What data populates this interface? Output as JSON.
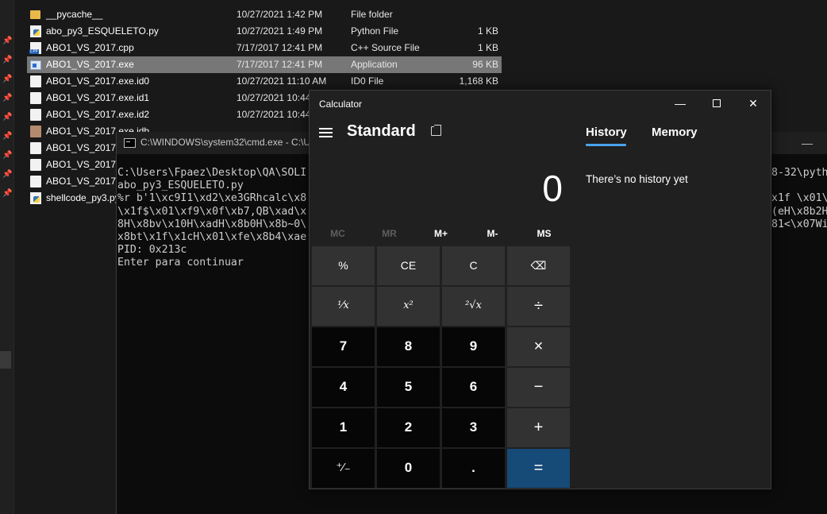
{
  "explorer": {
    "files": [
      {
        "name": "__pycache__",
        "date": "10/27/2021 1:42 PM",
        "type": "File folder",
        "size": "",
        "icon": "folder-icon"
      },
      {
        "name": "abo_py3_ESQUELETO.py",
        "date": "10/27/2021 1:49 PM",
        "type": "Python File",
        "size": "1 KB",
        "icon": "python-file-icon"
      },
      {
        "name": "ABO1_VS_2017.cpp",
        "date": "7/17/2017 12:41 PM",
        "type": "C++ Source File",
        "size": "1 KB",
        "icon": "cpp-file-icon"
      },
      {
        "name": "ABO1_VS_2017.exe",
        "date": "7/17/2017 12:41 PM",
        "type": "Application",
        "size": "96 KB",
        "icon": "application-icon",
        "selected": true
      },
      {
        "name": "ABO1_VS_2017.exe.id0",
        "date": "10/27/2021 11:10 AM",
        "type": "ID0 File",
        "size": "1,168 KB",
        "icon": "file-icon"
      },
      {
        "name": "ABO1_VS_2017.exe.id1",
        "date": "10/27/2021 10:44",
        "type": "",
        "size": "",
        "icon": "file-icon"
      },
      {
        "name": "ABO1_VS_2017.exe.id2",
        "date": "10/27/2021 10:44",
        "type": "",
        "size": "",
        "icon": "file-icon"
      },
      {
        "name": "ABO1_VS_2017.exe.idb",
        "date": "",
        "type": "",
        "size": "",
        "icon": "image-file-icon"
      },
      {
        "name": "ABO1_VS_2017.exe",
        "date": "",
        "type": "",
        "size": "",
        "icon": "file-icon"
      },
      {
        "name": "ABO1_VS_2017.exe",
        "date": "",
        "type": "",
        "size": "",
        "icon": "file-icon"
      },
      {
        "name": "ABO1_VS_2017.p",
        "date": "",
        "type": "",
        "size": "",
        "icon": "settings-file-icon"
      },
      {
        "name": "shellcode_py3.py",
        "date": "",
        "type": "",
        "size": "",
        "icon": "python-file-icon"
      }
    ]
  },
  "cmd": {
    "title": "C:\\WINDOWS\\system32\\cmd.exe - C:\\U",
    "lines": [
      "C:\\Users\\Fpaez\\Desktop\\QA\\SOLI",
      "abo_py3_ESQUELETO.py",
      "%r b'1\\xc9I1\\xd2\\xe3GRhcalc\\x8",
      "\\x1f$\\x01\\xf9\\x0f\\xb7,QB\\xad\\x",
      "8H\\x8bv\\x10H\\xadH\\x8b0H\\x8b~0\\",
      "x8bt\\x1f\\x1cH\\x01\\xfe\\x8b4\\xae",
      "PID: 0x213c",
      "Enter para continuar"
    ],
    "right_lines": [
      "8-32\\pyth",
      "",
      "x1f \\x01\\",
      "(eH\\x8b2H",
      "81<\\x07Wi",
      ""
    ]
  },
  "calculator": {
    "window_title": "Calculator",
    "mode": "Standard",
    "display": "0",
    "memory_buttons": [
      {
        "label": "MC",
        "enabled": false
      },
      {
        "label": "MR",
        "enabled": false
      },
      {
        "label": "M+",
        "enabled": true
      },
      {
        "label": "M-",
        "enabled": true
      },
      {
        "label": "MS",
        "enabled": true
      }
    ],
    "keys": {
      "percent": "%",
      "clear_entry": "CE",
      "clear": "C",
      "backspace": "⌫",
      "reciprocal": "¹⁄x",
      "square": "x²",
      "sqrt": "²√x",
      "divide": "÷",
      "seven": "7",
      "eight": "8",
      "nine": "9",
      "multiply": "×",
      "four": "4",
      "five": "5",
      "six": "6",
      "minus": "−",
      "one": "1",
      "two": "2",
      "three": "3",
      "plus": "+",
      "negate": "⁺⁄₋",
      "zero": "0",
      "decimal": ".",
      "equals": "="
    },
    "tabs": {
      "history": "History",
      "memory": "Memory"
    },
    "history_empty": "There’s no history yet",
    "accent_color": "#4aa3ec",
    "equals_color": "#164a77"
  }
}
